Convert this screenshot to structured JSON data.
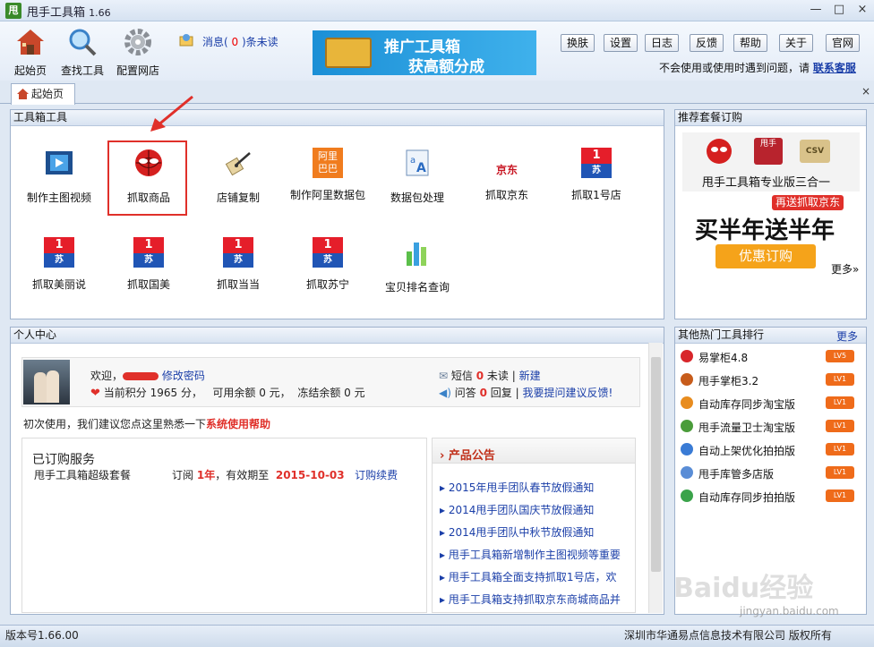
{
  "window": {
    "title": "甩手工具箱",
    "version": "1.66",
    "app_icon": "甩",
    "min": "—",
    "max": "□",
    "close": "×"
  },
  "toolbar": {
    "home": "起始页",
    "search": "查找工具",
    "config": "配置网店",
    "msg_prefix": "消息(",
    "msg_count": "0",
    "msg_suffix": ")条未读",
    "banner_l1": "推广工具箱",
    "banner_l2": "获高额分成",
    "buttons": [
      "换肤",
      "设置",
      "日志",
      "反馈",
      "帮助",
      "关于",
      "官网"
    ],
    "help_text": "不会使用或使用时遇到问题，请",
    "help_link": "联系客服"
  },
  "tab": {
    "label": "起始页",
    "close": "×"
  },
  "tools_panel": {
    "title": "工具箱工具",
    "row1": [
      "制作主图视频",
      "抓取商品",
      "店铺复制",
      "制作阿里数据包",
      "数据包处理",
      "抓取京东",
      "抓取1号店"
    ],
    "row2": [
      "抓取美丽说",
      "抓取国美",
      "抓取当当",
      "抓取苏宁",
      "宝贝排名查询"
    ]
  },
  "icons": {
    "suning_top": "1",
    "suning_text": "苏",
    "ali": "阿里巴巴",
    "ali_l1": "阿里",
    "ali_l2": "巴巴",
    "jd": "京东",
    "csv": "CSV"
  },
  "recommend": {
    "title": "推荐套餐订购",
    "product": "甩手工具箱专业版三合一",
    "tag": "再送抓取京东",
    "promo": "买半年送半年",
    "button": "优惠订购",
    "more": "更多»",
    "badge_text": "甩手"
  },
  "personal": {
    "title": "个人中心",
    "welcome": "欢迎，",
    "change_pwd": "修改密码",
    "points_label": "当前积分",
    "points": "1965",
    "points_unit": "分，",
    "avail": "可用余额 0 元，",
    "frozen": "冻结余额 0 元",
    "sms_label": "短信",
    "sms_count": "0",
    "sms_unread": "未读",
    "sms_new": "新建",
    "qa_label": "问答",
    "qa_count": "0",
    "qa_reply": "回复",
    "qa_link": "我要提问建议反馈!",
    "first_use": "初次使用，我们建议您点这里熟悉一下",
    "first_use_link": "系统使用帮助",
    "subscribed_title": "已订购服务",
    "service_name": "甩手工具箱超级套餐",
    "sub_label": "订阅",
    "sub_years": "1年",
    "sub_expiry_label": "，有效期至",
    "sub_expiry": "2015-10-03",
    "renew": "订购续费"
  },
  "announcements": {
    "title": "产品公告",
    "items": [
      "2015年甩手团队春节放假通知",
      "2014甩手团队国庆节放假通知",
      "2014甩手团队中秋节放假通知",
      "甩手工具箱新增制作主图视频等重要",
      "甩手工具箱全面支持抓取1号店，欢",
      "甩手工具箱支持抓取京东商城商品并"
    ]
  },
  "rank": {
    "title": "其他热门工具排行",
    "more": "更多",
    "items": [
      {
        "name": "易掌柜4.8",
        "lv": "LV5",
        "color": "#d8262b"
      },
      {
        "name": "甩手掌柜3.2",
        "lv": "LV1",
        "color": "#c75c1b"
      },
      {
        "name": "自动库存同步淘宝版",
        "lv": "LV1",
        "color": "#e88c1f"
      },
      {
        "name": "甩手流量卫士淘宝版",
        "lv": "LV1",
        "color": "#4a9c3a"
      },
      {
        "name": "自动上架优化拍拍版",
        "lv": "LV1",
        "color": "#3a7bd5"
      },
      {
        "name": "甩手库管多店版",
        "lv": "LV1",
        "color": "#5a8dd6"
      },
      {
        "name": "自动库存同步拍拍版",
        "lv": "LV1",
        "color": "#3aa34a"
      }
    ]
  },
  "status": {
    "version": "版本号1.66.00",
    "company": "深圳市华通易点信息技术有限公司 版权所有"
  },
  "watermark": {
    "brand": "Baidu经验",
    "url": "jingyan.baidu.com"
  }
}
